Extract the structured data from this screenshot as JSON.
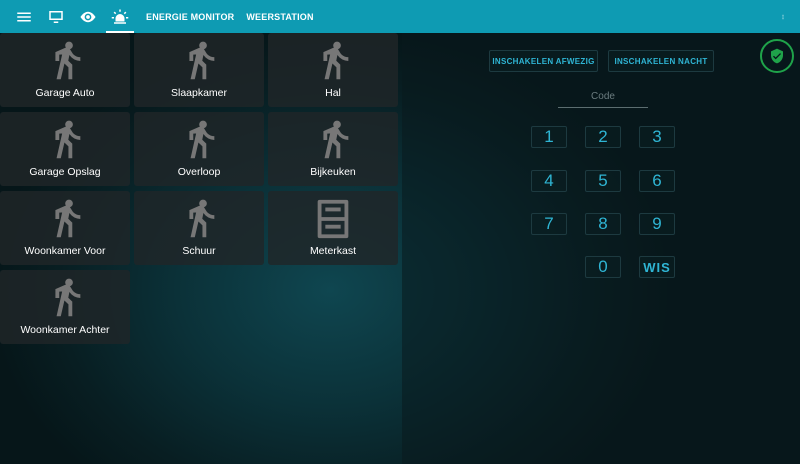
{
  "topbar": {
    "menu_icon": "hamburger-icon",
    "tabs": [
      {
        "icon": "monitor-icon"
      },
      {
        "icon": "eye-icon"
      },
      {
        "icon": "alarm-light-icon",
        "active": true
      }
    ],
    "text_tabs": [
      "ENERGIE MONITOR",
      "WEERSTATION"
    ],
    "overflow_icon": "dots-vertical-icon"
  },
  "sensors": [
    {
      "label": "Garage Auto",
      "icon": "walk-icon"
    },
    {
      "label": "Slaapkamer",
      "icon": "walk-icon"
    },
    {
      "label": "Hal",
      "icon": "walk-icon"
    },
    {
      "label": "Garage Opslag",
      "icon": "walk-icon"
    },
    {
      "label": "Overloop",
      "icon": "walk-icon"
    },
    {
      "label": "Bijkeuken",
      "icon": "walk-icon"
    },
    {
      "label": "Woonkamer Voor",
      "icon": "walk-icon"
    },
    {
      "label": "Schuur",
      "icon": "walk-icon"
    },
    {
      "label": "Meterkast",
      "icon": "cabinet-icon"
    },
    {
      "label": "Woonkamer Achter",
      "icon": "walk-icon"
    }
  ],
  "alarm": {
    "arm_away": "INSCHAKELEN AFWEZIG",
    "arm_night": "INSCHAKELEN NACHT",
    "status_icon": "shield-check-icon",
    "status_color": "#1fa34a",
    "code_placeholder": "Code",
    "keys": [
      "1",
      "2",
      "3",
      "4",
      "5",
      "6",
      "7",
      "8",
      "9",
      "0"
    ],
    "clear": "WIS",
    "accent": "#2fb5d4"
  }
}
